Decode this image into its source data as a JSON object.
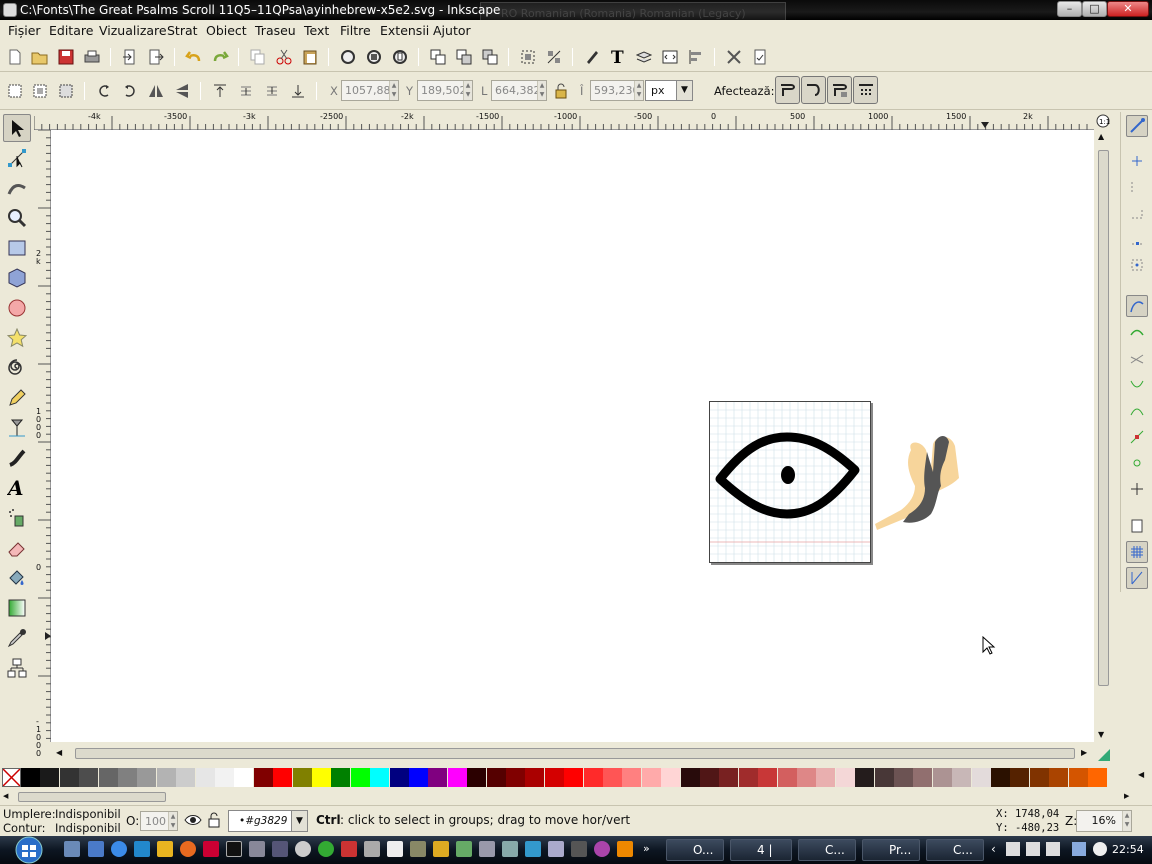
{
  "window": {
    "title": "C:\\Fonts\\The Great Psalms Scroll 11Q5–11QPsa\\ayinhebrew-x5e2.svg - Inkscape",
    "lang_ghost": "RO Romanian (Romania)    Romanian (Legacy)",
    "btn_min": "–",
    "btn_max": "□",
    "btn_close": "✕"
  },
  "menu": [
    "Fișier",
    "Editare",
    "Vizualizare",
    "Strat",
    "Obiect",
    "Traseu",
    "Text",
    "Filtre",
    "Extensii",
    "Ajutor"
  ],
  "ctrl": {
    "x_label": "X",
    "x_value": "1057,88",
    "y_label": "Y",
    "y_value": "189,502",
    "w_label": "L",
    "w_value": "664,382",
    "h_label": "Î",
    "h_value": "593,230",
    "unit": "px",
    "affect_label": "Afectează:"
  },
  "ruler_top": [
    "-4k",
    "-3500",
    "-3k",
    "-2500",
    "-2k",
    "-1500",
    "-1000",
    "-500",
    "0",
    "500",
    "1000",
    "1500",
    "2k"
  ],
  "ruler_left": [
    "2k",
    "1000",
    "0",
    "-1000"
  ],
  "status": {
    "fill_label": "Umplere:",
    "fill_value": "Indisponibil",
    "stroke_label": "Contur:",
    "stroke_value": "Indisponibil",
    "opacity_label": "O:",
    "opacity_value": "100",
    "layer": "•#g3829",
    "message_key": "Ctrl",
    "message": ": click to select in groups; drag to move hor/vert",
    "cursor_x": "X: 1748,04",
    "cursor_y": "Y: -480,23",
    "zoom_label": "Z:",
    "zoom_value": "16%"
  },
  "taskbar": {
    "tasks": [
      "O...",
      "4 |",
      "C...",
      "Pr...",
      "C..."
    ],
    "time": "22:54"
  },
  "palette": [
    "#000000",
    "#1a1a1a",
    "#333333",
    "#4d4d4d",
    "#666666",
    "#808080",
    "#999999",
    "#b3b3b3",
    "#cccccc",
    "#e6e6e6",
    "#f2f2f2",
    "#ffffff",
    "#800000",
    "#ff0000",
    "#808000",
    "#ffff00",
    "#008000",
    "#00ff00",
    "#00ffff",
    "#000080",
    "#0000ff",
    "#800080",
    "#ff00ff",
    "#2b0000",
    "#550000",
    "#800000",
    "#aa0000",
    "#d40000",
    "#ff0000",
    "#ff2a2a",
    "#ff5555",
    "#ff8080",
    "#ffaaaa",
    "#ffd5d5",
    "#280b0b",
    "#501616",
    "#782121",
    "#a02c2c",
    "#c83737",
    "#d35f5f",
    "#de8787",
    "#e9afaf",
    "#f4d7d7",
    "#241c1c",
    "#483737",
    "#6c5353",
    "#916f6f",
    "#ac9393",
    "#c8b7b7",
    "#e3dbdb",
    "#2b1100",
    "#552200",
    "#803300",
    "#aa4400",
    "#d45500",
    "#ff6600"
  ]
}
